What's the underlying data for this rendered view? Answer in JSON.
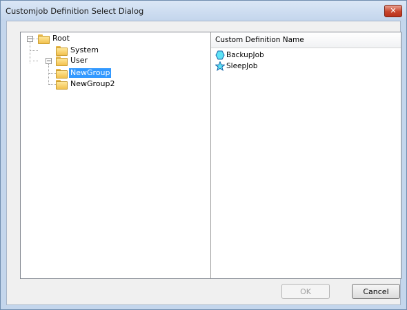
{
  "window": {
    "title": "Customjob Definition Select Dialog",
    "close_glyph": "✕"
  },
  "tree": {
    "nodes": [
      {
        "label": "Root",
        "expander": "−"
      },
      {
        "label": "System"
      },
      {
        "label": "User",
        "expander": "−"
      },
      {
        "label": "NewGroup",
        "selected": true
      },
      {
        "label": "NewGroup2"
      }
    ]
  },
  "list": {
    "header": "Custom Definition Name",
    "items": [
      {
        "label": "BackupJob",
        "icon": "hexagon-icon"
      },
      {
        "label": "SleepJob",
        "icon": "star-icon"
      }
    ]
  },
  "buttons": {
    "ok_label": "OK",
    "cancel_label": "Cancel"
  },
  "colors": {
    "selection": "#3399ff",
    "icon_fill": "#5fe3f5",
    "close": "#c8442b"
  }
}
